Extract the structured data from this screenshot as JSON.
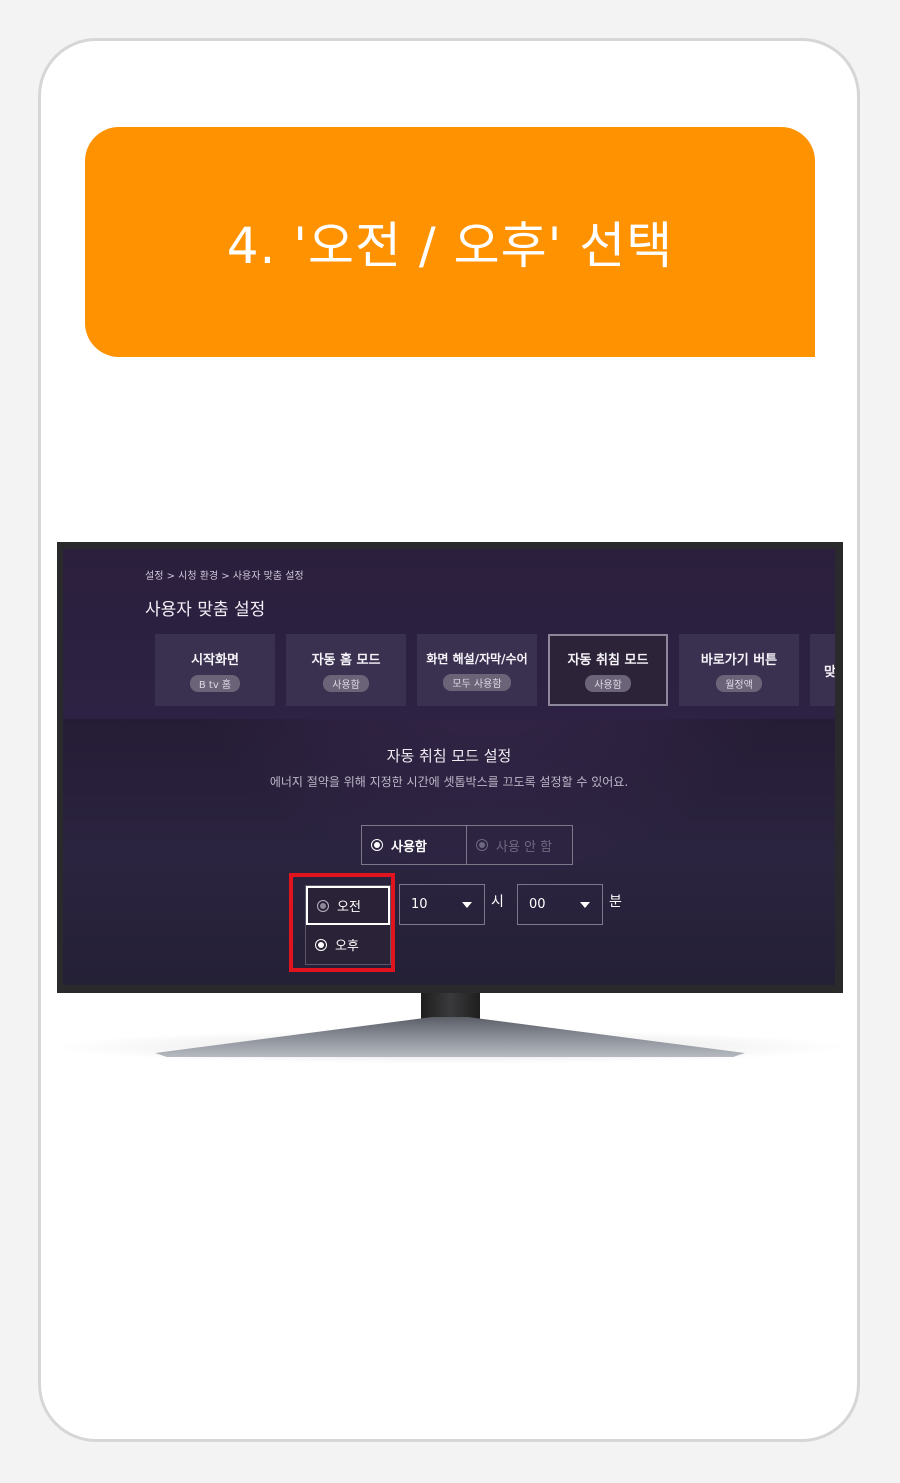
{
  "banner": {
    "title": "4. '오전 / 오후' 선택"
  },
  "screen": {
    "breadcrumb": "설정 > 시청 환경 > 사용자 맞춤 설정",
    "title": "사용자 맞춤 설정",
    "tabs": [
      {
        "label": "시작화면",
        "badge": "B tv 홈"
      },
      {
        "label": "자동 홈 모드",
        "badge": "사용함"
      },
      {
        "label": "화면 해설/자막/수어",
        "badge": "모두 사용함"
      },
      {
        "label": "자동 취침 모드",
        "badge": "사용함"
      },
      {
        "label": "바로가기 버튼",
        "badge": "월정액"
      },
      {
        "label": "맞"
      }
    ],
    "section_title": "자동 취침 모드 설정",
    "section_desc": "에너지 절약을 위해 지정한 시간에 셋톱박스를 끄도록 설정할 수 있어요.",
    "toggle": {
      "on_label": "사용함",
      "off_label": "사용 안 함"
    },
    "ampm": {
      "am_label": "오전",
      "pm_label": "오후"
    },
    "hour": {
      "value": "10",
      "unit": "시"
    },
    "minute": {
      "value": "00",
      "unit": "분"
    }
  },
  "colors": {
    "banner": "#ff9200",
    "highlight": "#e0141e",
    "screen_bg": "#2a1f3b"
  }
}
